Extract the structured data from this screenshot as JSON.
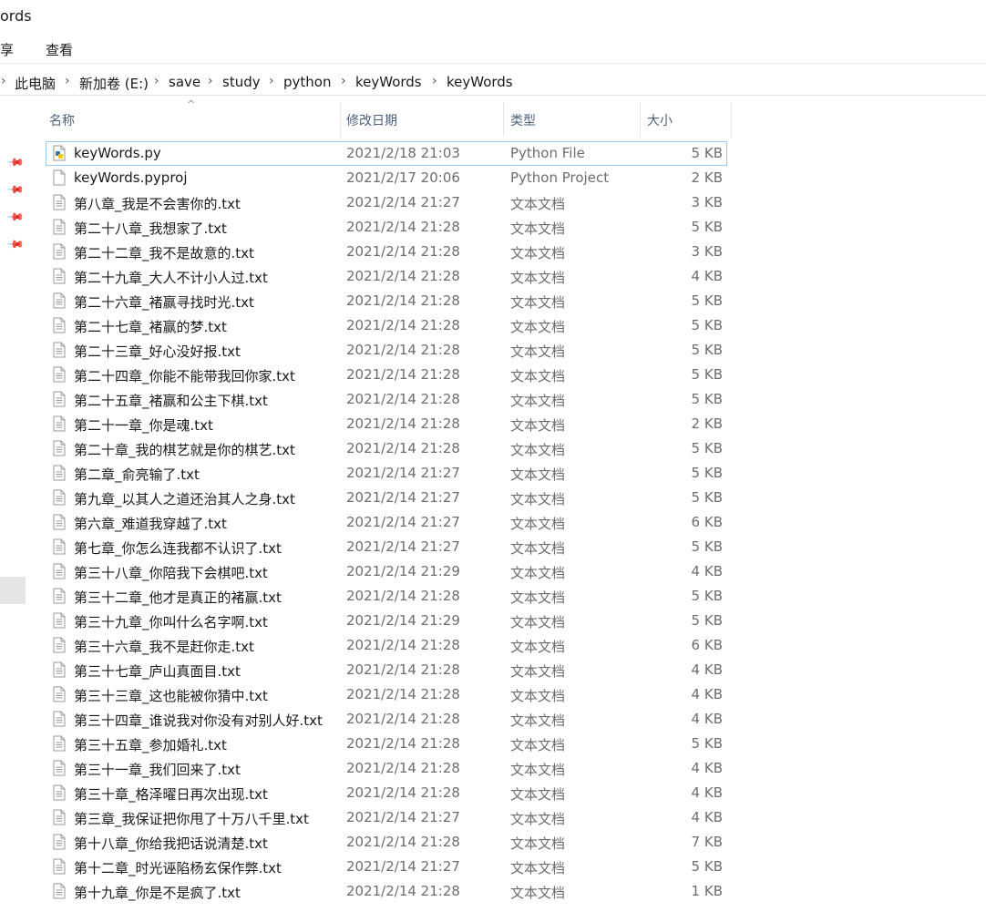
{
  "window": {
    "title": "ords"
  },
  "ribbon": {
    "tabs": [
      "享",
      "查看"
    ]
  },
  "address": {
    "crumbs": [
      "此电脑",
      "新加卷 (E:)",
      "save",
      "study",
      "python",
      "keyWords",
      "keyWords"
    ]
  },
  "columns": {
    "name": "名称",
    "date": "修改日期",
    "type": "类型",
    "size": "大小"
  },
  "files": [
    {
      "name": "keyWords.py",
      "date": "2021/2/18 21:03",
      "type": "Python File",
      "size": "5 KB",
      "icon": "python-file-icon"
    },
    {
      "name": "keyWords.pyproj",
      "date": "2021/2/17 20:06",
      "type": "Python Project",
      "size": "2 KB",
      "icon": "blank-file-icon"
    },
    {
      "name": "第八章_我是不会害你的.txt",
      "date": "2021/2/14 21:27",
      "type": "文本文档",
      "size": "3 KB",
      "icon": "text-file-icon"
    },
    {
      "name": "第二十八章_我想家了.txt",
      "date": "2021/2/14 21:28",
      "type": "文本文档",
      "size": "5 KB",
      "icon": "text-file-icon"
    },
    {
      "name": "第二十二章_我不是故意的.txt",
      "date": "2021/2/14 21:28",
      "type": "文本文档",
      "size": "3 KB",
      "icon": "text-file-icon"
    },
    {
      "name": "第二十九章_大人不计小人过.txt",
      "date": "2021/2/14 21:28",
      "type": "文本文档",
      "size": "4 KB",
      "icon": "text-file-icon"
    },
    {
      "name": "第二十六章_褚赢寻找时光.txt",
      "date": "2021/2/14 21:28",
      "type": "文本文档",
      "size": "5 KB",
      "icon": "text-file-icon"
    },
    {
      "name": "第二十七章_褚赢的梦.txt",
      "date": "2021/2/14 21:28",
      "type": "文本文档",
      "size": "5 KB",
      "icon": "text-file-icon"
    },
    {
      "name": "第二十三章_好心没好报.txt",
      "date": "2021/2/14 21:28",
      "type": "文本文档",
      "size": "5 KB",
      "icon": "text-file-icon"
    },
    {
      "name": "第二十四章_你能不能带我回你家.txt",
      "date": "2021/2/14 21:28",
      "type": "文本文档",
      "size": "5 KB",
      "icon": "text-file-icon"
    },
    {
      "name": "第二十五章_褚赢和公主下棋.txt",
      "date": "2021/2/14 21:28",
      "type": "文本文档",
      "size": "5 KB",
      "icon": "text-file-icon"
    },
    {
      "name": "第二十一章_你是魂.txt",
      "date": "2021/2/14 21:28",
      "type": "文本文档",
      "size": "2 KB",
      "icon": "text-file-icon"
    },
    {
      "name": "第二十章_我的棋艺就是你的棋艺.txt",
      "date": "2021/2/14 21:28",
      "type": "文本文档",
      "size": "5 KB",
      "icon": "text-file-icon"
    },
    {
      "name": "第二章_俞亮输了.txt",
      "date": "2021/2/14 21:27",
      "type": "文本文档",
      "size": "5 KB",
      "icon": "text-file-icon"
    },
    {
      "name": "第九章_以其人之道还治其人之身.txt",
      "date": "2021/2/14 21:27",
      "type": "文本文档",
      "size": "5 KB",
      "icon": "text-file-icon"
    },
    {
      "name": "第六章_难道我穿越了.txt",
      "date": "2021/2/14 21:27",
      "type": "文本文档",
      "size": "6 KB",
      "icon": "text-file-icon"
    },
    {
      "name": "第七章_你怎么连我都不认识了.txt",
      "date": "2021/2/14 21:27",
      "type": "文本文档",
      "size": "5 KB",
      "icon": "text-file-icon"
    },
    {
      "name": "第三十八章_你陪我下会棋吧.txt",
      "date": "2021/2/14 21:29",
      "type": "文本文档",
      "size": "4 KB",
      "icon": "text-file-icon"
    },
    {
      "name": "第三十二章_他才是真正的褚赢.txt",
      "date": "2021/2/14 21:28",
      "type": "文本文档",
      "size": "5 KB",
      "icon": "text-file-icon"
    },
    {
      "name": "第三十九章_你叫什么名字啊.txt",
      "date": "2021/2/14 21:29",
      "type": "文本文档",
      "size": "5 KB",
      "icon": "text-file-icon"
    },
    {
      "name": "第三十六章_我不是赶你走.txt",
      "date": "2021/2/14 21:28",
      "type": "文本文档",
      "size": "6 KB",
      "icon": "text-file-icon"
    },
    {
      "name": "第三十七章_庐山真面目.txt",
      "date": "2021/2/14 21:28",
      "type": "文本文档",
      "size": "4 KB",
      "icon": "text-file-icon"
    },
    {
      "name": "第三十三章_这也能被你猜中.txt",
      "date": "2021/2/14 21:28",
      "type": "文本文档",
      "size": "4 KB",
      "icon": "text-file-icon"
    },
    {
      "name": "第三十四章_谁说我对你没有对别人好.txt",
      "date": "2021/2/14 21:28",
      "type": "文本文档",
      "size": "4 KB",
      "icon": "text-file-icon"
    },
    {
      "name": "第三十五章_参加婚礼.txt",
      "date": "2021/2/14 21:28",
      "type": "文本文档",
      "size": "5 KB",
      "icon": "text-file-icon"
    },
    {
      "name": "第三十一章_我们回来了.txt",
      "date": "2021/2/14 21:28",
      "type": "文本文档",
      "size": "4 KB",
      "icon": "text-file-icon"
    },
    {
      "name": "第三十章_格泽曜日再次出现.txt",
      "date": "2021/2/14 21:28",
      "type": "文本文档",
      "size": "4 KB",
      "icon": "text-file-icon"
    },
    {
      "name": "第三章_我保证把你甩了十万八千里.txt",
      "date": "2021/2/14 21:27",
      "type": "文本文档",
      "size": "4 KB",
      "icon": "text-file-icon"
    },
    {
      "name": "第十八章_你给我把话说清楚.txt",
      "date": "2021/2/14 21:28",
      "type": "文本文档",
      "size": "7 KB",
      "icon": "text-file-icon"
    },
    {
      "name": "第十二章_时光诬陷杨玄保作弊.txt",
      "date": "2021/2/14 21:27",
      "type": "文本文档",
      "size": "5 KB",
      "icon": "text-file-icon"
    },
    {
      "name": "第十九章_你是不是疯了.txt",
      "date": "2021/2/14 21:28",
      "type": "文本文档",
      "size": "1 KB",
      "icon": "text-file-icon"
    }
  ]
}
